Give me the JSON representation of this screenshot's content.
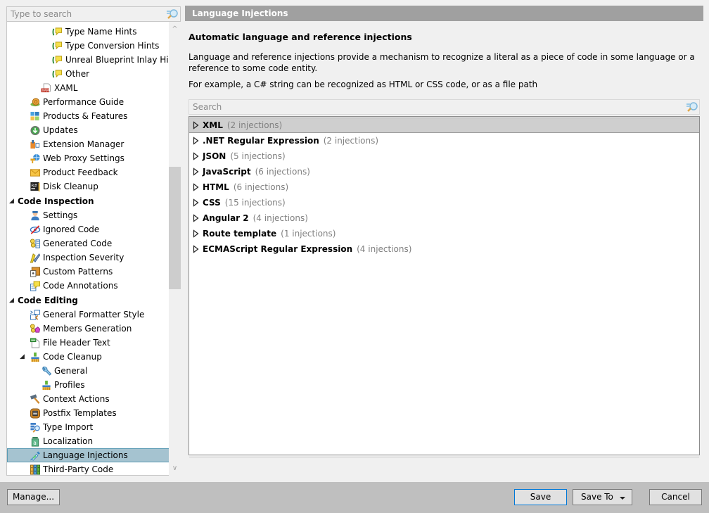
{
  "sidebar": {
    "search_placeholder": "Type to search",
    "items": [
      {
        "label": "Type Name Hints",
        "icon": "inlay-hints-icon",
        "level": 3
      },
      {
        "label": "Type Conversion Hints",
        "icon": "inlay-hints-icon",
        "level": 3
      },
      {
        "label": "Unreal Blueprint Inlay Hints",
        "icon": "inlay-hints-icon",
        "level": 3
      },
      {
        "label": "Other",
        "icon": "inlay-hints-icon",
        "level": 3
      },
      {
        "label": "XAML",
        "icon": "xaml-file-icon",
        "level": 2
      },
      {
        "label": "Performance Guide",
        "icon": "snail-icon",
        "level": 1
      },
      {
        "label": "Products & Features",
        "icon": "products-grid-icon",
        "level": 1
      },
      {
        "label": "Updates",
        "icon": "download-circle-icon",
        "level": 1
      },
      {
        "label": "Extension Manager",
        "icon": "extension-icon",
        "level": 1
      },
      {
        "label": "Web Proxy Settings",
        "icon": "globe-plug-icon",
        "level": 1
      },
      {
        "label": "Product Feedback",
        "icon": "envelope-icon",
        "level": 1
      },
      {
        "label": "Disk Cleanup",
        "icon": "resharper-icon",
        "level": 1
      },
      {
        "label": "Code Inspection",
        "icon": "expanded-arrow-icon",
        "level": 0,
        "group": true
      },
      {
        "label": "Settings",
        "icon": "inspector-icon",
        "level": 1
      },
      {
        "label": "Ignored Code",
        "icon": "ignored-eye-icon",
        "level": 1
      },
      {
        "label": "Generated Code",
        "icon": "generated-code-icon",
        "level": 1
      },
      {
        "label": "Inspection Severity",
        "icon": "severity-pen-icon",
        "level": 1
      },
      {
        "label": "Custom Patterns",
        "icon": "custom-patterns-icon",
        "level": 1
      },
      {
        "label": "Code Annotations",
        "icon": "annotation-icon",
        "level": 1
      },
      {
        "label": "Code Editing",
        "icon": "expanded-arrow-icon",
        "level": 0,
        "group": true
      },
      {
        "label": "General Formatter Style",
        "icon": "formatter-icon",
        "level": 1
      },
      {
        "label": "Members Generation",
        "icon": "members-gen-icon",
        "level": 1
      },
      {
        "label": "File Header Text",
        "icon": "file-header-icon",
        "level": 1
      },
      {
        "label": "Code Cleanup",
        "icon": "broom-icon",
        "level": 1,
        "expanded": true
      },
      {
        "label": "General",
        "icon": "wrench-icon",
        "level": 2
      },
      {
        "label": "Profiles",
        "icon": "broom-icon",
        "level": 2
      },
      {
        "label": "Context Actions",
        "icon": "hammer-icon",
        "level": 1
      },
      {
        "label": "Postfix Templates",
        "icon": "postfix-icon",
        "level": 1
      },
      {
        "label": "Type Import",
        "icon": "type-import-icon",
        "level": 1
      },
      {
        "label": "Localization",
        "icon": "localization-icon",
        "level": 1
      },
      {
        "label": "Language Injections",
        "icon": "syringe-icon",
        "level": 1,
        "selected": true
      },
      {
        "label": "Third-Party Code",
        "icon": "books-icon",
        "level": 1
      }
    ]
  },
  "page": {
    "header": "Language Injections",
    "subtitle": "Automatic language and reference injections",
    "description": "Language and reference injections provide a mechanism to recognize a literal as a piece of code in some language or a reference to some code entity.",
    "example": "For example, a C# string can be recognized as HTML or CSS code, or as a file path",
    "search_placeholder": "Search",
    "injections": [
      {
        "name": "XML",
        "count": "(2 injections)",
        "highlighted": true
      },
      {
        "name": ".NET Regular Expression",
        "count": "(2 injections)"
      },
      {
        "name": "JSON",
        "count": "(5 injections)"
      },
      {
        "name": "JavaScript",
        "count": "(6 injections)"
      },
      {
        "name": "HTML",
        "count": "(6 injections)"
      },
      {
        "name": "CSS",
        "count": "(15 injections)"
      },
      {
        "name": "Angular 2",
        "count": "(4 injections)"
      },
      {
        "name": "Route template",
        "count": "(1 injections)"
      },
      {
        "name": "ECMAScript Regular Expression",
        "count": "(4 injections)"
      }
    ]
  },
  "footer": {
    "manage_label": "Manage...",
    "save_label": "Save",
    "save_to_label": "Save To",
    "cancel_label": "Cancel"
  },
  "colors": {
    "header_bg": "#a0a0a0",
    "selected_bg": "#a5c3d0",
    "selected_border": "#5a9ab3",
    "footer_bg": "#bfbfbf",
    "default_button_border": "#0078d7"
  }
}
